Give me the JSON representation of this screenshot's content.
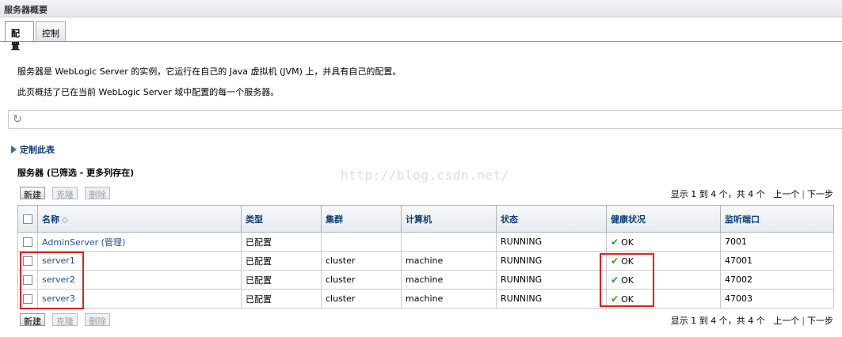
{
  "page": {
    "title": "服务器概要"
  },
  "tabs": [
    {
      "label": "配置",
      "active": true
    },
    {
      "label": "控制",
      "active": false
    }
  ],
  "description": {
    "line1": "服务器是 WebLogic Server 的实例，它运行在自己的 Java 虚拟机 (JVM) 上，并具有自己的配置。",
    "line2": "此页概括了已在当前 WebLogic Server 域中配置的每一个服务器。"
  },
  "refresh": {
    "icon": "refresh-icon"
  },
  "customize": {
    "label": "定制此表"
  },
  "section": {
    "title": "服务器 (已筛选 - 更多列存在)"
  },
  "watermark": "http://blog.csdn.net/",
  "toolbar": {
    "new_label": "新建",
    "clone_label": "克隆",
    "delete_label": "删除"
  },
  "pager": {
    "summary": "显示 1 到 4 个，共 4 个",
    "prev_label": "上一个",
    "separator": "|",
    "next_label": "下一步"
  },
  "table": {
    "columns": [
      "名称",
      "类型",
      "集群",
      "计算机",
      "状态",
      "健康状况",
      "监听端口"
    ],
    "rows": [
      {
        "name": "AdminServer (管理)",
        "type": "已配置",
        "cluster": "",
        "machine": "",
        "state": "RUNNING",
        "health": "OK",
        "port": "7001"
      },
      {
        "name": "server1",
        "type": "已配置",
        "cluster": "cluster",
        "machine": "machine",
        "state": "RUNNING",
        "health": "OK",
        "port": "47001"
      },
      {
        "name": "server2",
        "type": "已配置",
        "cluster": "cluster",
        "machine": "machine",
        "state": "RUNNING",
        "health": "OK",
        "port": "47002"
      },
      {
        "name": "server3",
        "type": "已配置",
        "cluster": "cluster",
        "machine": "machine",
        "state": "RUNNING",
        "health": "OK",
        "port": "47003"
      }
    ]
  },
  "colors": {
    "link": "#1a4f9c",
    "header_text": "#0b3f7a",
    "ok_check": "#2f9a2f",
    "highlight_box": "#e02020"
  }
}
